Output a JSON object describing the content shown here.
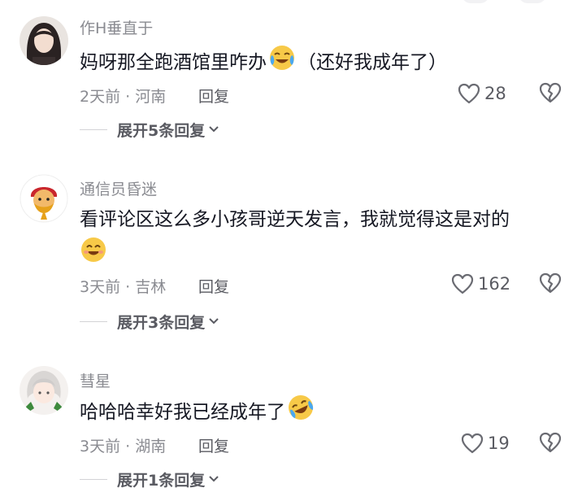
{
  "colors": {
    "username": "#8a8b91",
    "text": "#161823",
    "secondary": "#5a5b62",
    "divider": "#d3d3d6"
  },
  "comments": [
    {
      "username": "作H垂直于",
      "text": "妈呀那全跑酒馆里咋办",
      "emoji": "crying-laughing-emoji",
      "text_after": "（还好我成年了）",
      "meta": "2天前 · 河南",
      "reply_label": "回复",
      "likes": "28",
      "expand_label": "展开5条回复"
    },
    {
      "username": "通信员昏迷",
      "text": "看评论区这么多小孩哥逆天发言，我就觉得这是对的",
      "emoji": "smiling-emoji",
      "meta": "3天前 · 吉林",
      "reply_label": "回复",
      "likes": "162",
      "expand_label": "展开3条回复"
    },
    {
      "username": "彗星",
      "text": "哈哈哈幸好我已经成年了",
      "emoji": "rofl-emoji",
      "meta": "3天前 · 湖南",
      "reply_label": "回复",
      "likes": "19",
      "expand_label": "展开1条回复"
    }
  ]
}
